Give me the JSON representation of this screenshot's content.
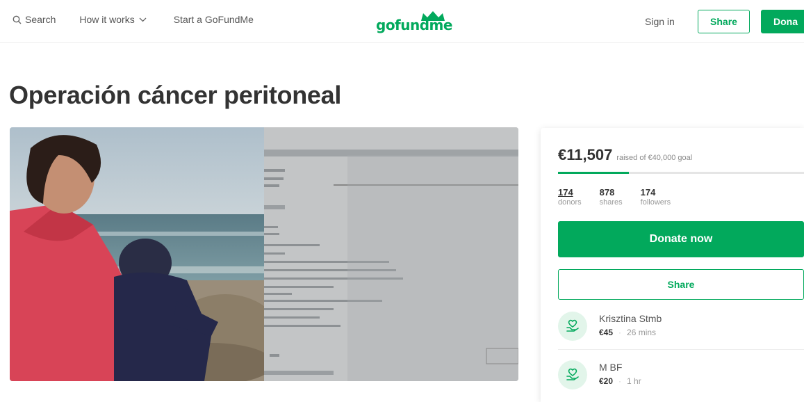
{
  "header": {
    "search_label": "Search",
    "how_it_works_label": "How it works",
    "start_label": "Start a GoFundMe",
    "logo_text": "gofundme",
    "signin_label": "Sign in",
    "share_label": "Share",
    "donate_label": "Dona"
  },
  "page": {
    "title": "Operación cáncer peritoneal"
  },
  "campaign": {
    "raised_amount": "€11,507",
    "raised_goal_text": "raised of €40,000 goal",
    "progress_fraction": 0.288,
    "stats": [
      {
        "num": "174",
        "label": "donors"
      },
      {
        "num": "878",
        "label": "shares"
      },
      {
        "num": "174",
        "label": "followers"
      }
    ],
    "donate_now_label": "Donate now",
    "share_label": "Share",
    "donations": [
      {
        "name": "Krisztina Stmb",
        "amount": "€45",
        "time": "26 mins"
      },
      {
        "name": "M BF",
        "amount": "€20",
        "time": "1 hr"
      }
    ]
  },
  "colors": {
    "brand_green": "#02a95c"
  },
  "icons": {
    "search": "search-icon",
    "chevron": "chevron-down-icon",
    "crown": "crown-logo-icon",
    "donor": "donor-hand-heart-icon"
  }
}
